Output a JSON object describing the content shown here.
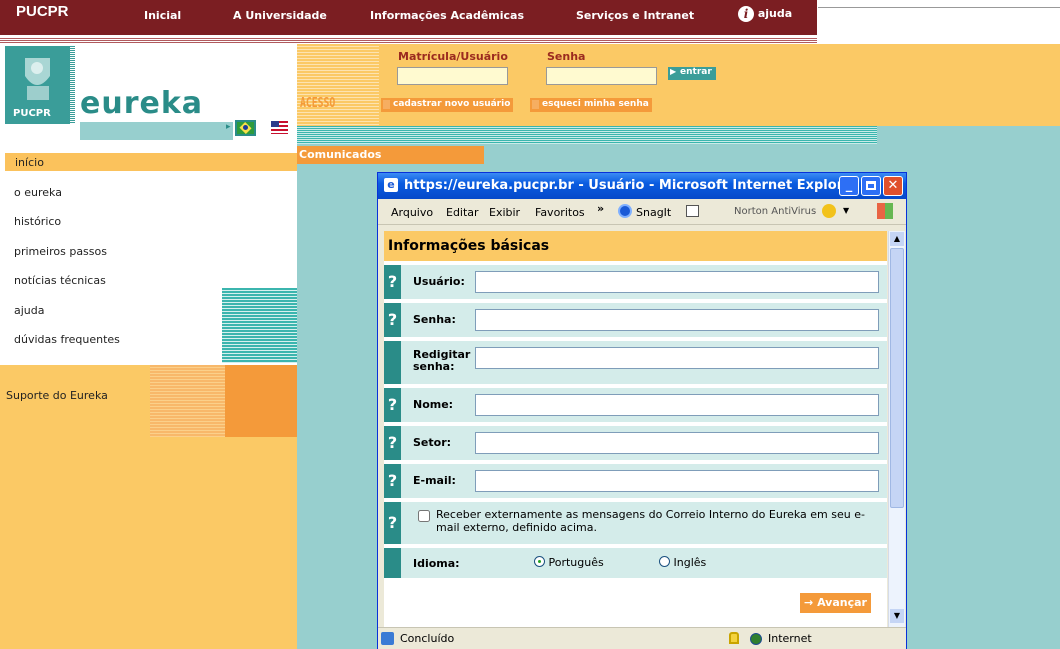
{
  "topnav": {
    "logo": "PUCPR",
    "items": [
      "Inicial",
      "A Universidade",
      "Informações Acadêmicas",
      "Serviços e Intranet"
    ],
    "help": "ajuda"
  },
  "brand": {
    "logo_text": "PUCPR",
    "name": "eureka"
  },
  "menu": {
    "items": [
      "início",
      "o eureka",
      "histórico",
      "primeiros passos",
      "notícias técnicas",
      "ajuda",
      "dúvidas frequentes"
    ],
    "support": "Suporte do Eureka"
  },
  "login": {
    "acesso": "ACESSO",
    "user_label": "Matrícula/Usuário",
    "password_label": "Senha",
    "enter_button": "entrar",
    "register_link": "cadastrar novo usuário",
    "forgot_link": "esqueci minha senha"
  },
  "comunicados": "Comunicados",
  "ie": {
    "title": "https://eureka.pucpr.br - Usuário - Microsoft Internet Explorer",
    "menu": [
      "Arquivo",
      "Editar",
      "Exibir",
      "Favoritos"
    ],
    "chevron": "»",
    "snagit": "SnagIt",
    "norton": "Norton AntiVirus",
    "status": "Concluído",
    "zone": "Internet"
  },
  "form": {
    "heading": "Informações básicas",
    "help_mark": "?",
    "fields": [
      "Usuário:",
      "Senha:",
      "Redigitar senha:",
      "Nome:",
      "Setor:",
      "E-mail:"
    ],
    "checkbox_text": "Receber externamente as mensagens do Correio Interno do Eureka em seu e-mail externo, definido acima.",
    "language_label": "Idioma:",
    "language_options": [
      "Português",
      "Inglês"
    ],
    "language_selected": "Português",
    "next_button": "Avançar"
  },
  "colors": {
    "nav": "#7b1e22",
    "teal": "#2a8c88",
    "orange": "#f49a3a",
    "yellow": "#fbc965",
    "light_teal": "#97cfce"
  }
}
